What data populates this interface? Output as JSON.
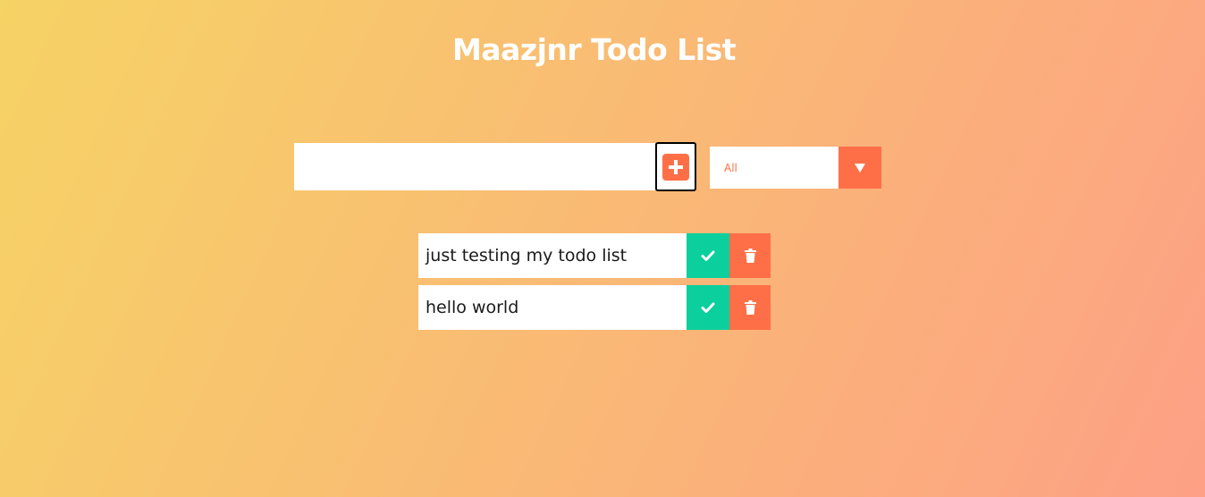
{
  "header": {
    "title": "Maazjnr Todo List"
  },
  "form": {
    "input_value": "",
    "input_placeholder": "",
    "add_icon": "plus-square-icon"
  },
  "filter": {
    "selected": "All",
    "arrow_icon": "caret-down-icon"
  },
  "todos": [
    {
      "text": "just testing my todo list",
      "complete_icon": "check-icon",
      "delete_icon": "trash-icon"
    },
    {
      "text": "hello world",
      "complete_icon": "check-icon",
      "delete_icon": "trash-icon"
    }
  ],
  "colors": {
    "gradient_start": "#f6d365",
    "gradient_end": "#fda085",
    "accent": "#ff6f47",
    "complete": "#0bcf9c"
  }
}
